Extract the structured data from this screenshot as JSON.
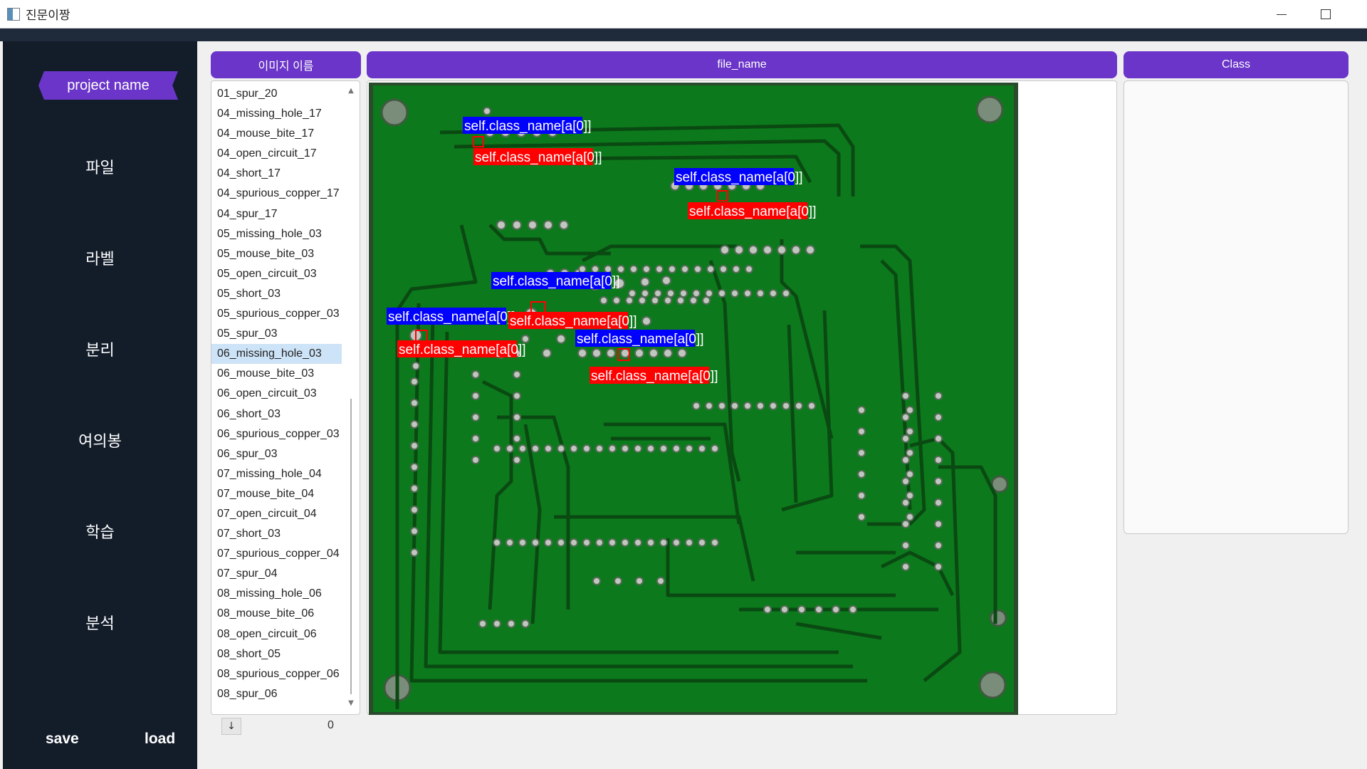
{
  "window": {
    "title": "진문이짱",
    "app_icon": "app-icon",
    "minimize_icon": "minimize-icon",
    "maximize_icon": "maximize-icon"
  },
  "sidebar": {
    "project_name": "project name",
    "nav": [
      {
        "label": "파일"
      },
      {
        "label": "라벨"
      },
      {
        "label": "분리"
      },
      {
        "label": "여의봉"
      },
      {
        "label": "학습"
      },
      {
        "label": "분석"
      }
    ],
    "save_label": "save",
    "load_label": "load"
  },
  "headers": {
    "image_list": "이미지 이름",
    "file_name": "file_name",
    "class": "Class"
  },
  "image_list": {
    "items": [
      "01_spur_20",
      "04_missing_hole_17",
      "04_mouse_bite_17",
      "04_open_circuit_17",
      "04_short_17",
      "04_spurious_copper_17",
      "04_spur_17",
      "05_missing_hole_03",
      "05_mouse_bite_03",
      "05_open_circuit_03",
      "05_short_03",
      "05_spurious_copper_03",
      "05_spur_03",
      "06_missing_hole_03",
      "06_mouse_bite_03",
      "06_open_circuit_03",
      "06_short_03",
      "06_spurious_copper_03",
      "06_spur_03",
      "07_missing_hole_04",
      "07_mouse_bite_04",
      "07_open_circuit_04",
      "07_short_03",
      "07_spurious_copper_04",
      "07_spur_04",
      "08_missing_hole_06",
      "08_mouse_bite_06",
      "08_open_circuit_06",
      "08_short_05",
      "08_spurious_copper_06",
      "08_spur_06"
    ],
    "selected": "06_missing_hole_03",
    "down_button": "↓",
    "count": "0"
  },
  "annotations": {
    "label_text": "self.class_name[a[0]]",
    "label_colors": {
      "blue": "#0000ff",
      "red": "#ff0000"
    }
  },
  "colors": {
    "accent": "#6a35c8",
    "sidebar": "#131d2a",
    "pcb": "#0c7a1c",
    "trace": "#0a4a12"
  }
}
